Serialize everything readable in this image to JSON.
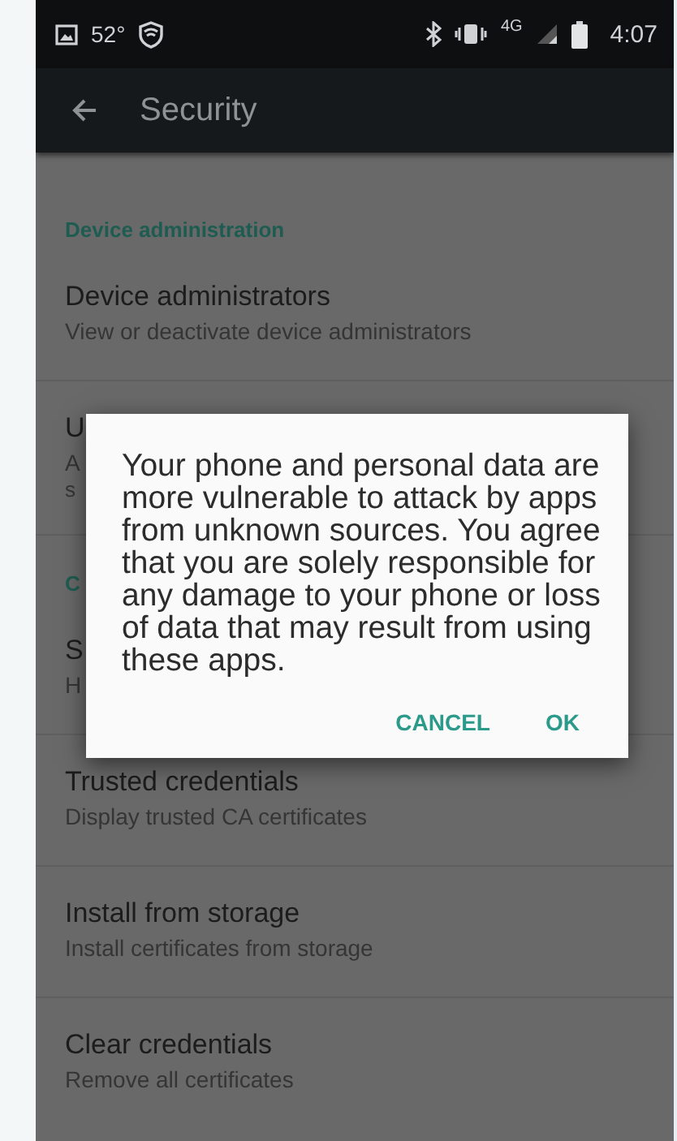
{
  "status_bar": {
    "temperature": "52°",
    "network": "4G",
    "time": "4:07"
  },
  "toolbar": {
    "title": "Security"
  },
  "sections": [
    {
      "header": "Device administration",
      "items": [
        {
          "title": "Device administrators",
          "subtitle_lines": [
            "View or deactivate device administrators"
          ]
        },
        {
          "title": "U",
          "subtitle_lines": [
            "A",
            "s"
          ]
        }
      ]
    },
    {
      "header": "C",
      "items": [
        {
          "title": "S",
          "subtitle_lines": [
            "H"
          ]
        },
        {
          "title": "Trusted credentials",
          "subtitle_lines": [
            "Display trusted CA certificates"
          ]
        },
        {
          "title": "Install from storage",
          "subtitle_lines": [
            "Install certificates from storage"
          ]
        },
        {
          "title": "Clear credentials",
          "subtitle_lines": [
            "Remove all certificates"
          ]
        }
      ]
    }
  ],
  "dialog": {
    "message": "Your phone and personal data are more vulnerable to attack by apps from unknown sources. You agree that you are solely responsible for any damage to your phone or loss of data that may result from using these apps.",
    "buttons": [
      "CANCEL",
      "OK"
    ]
  }
}
